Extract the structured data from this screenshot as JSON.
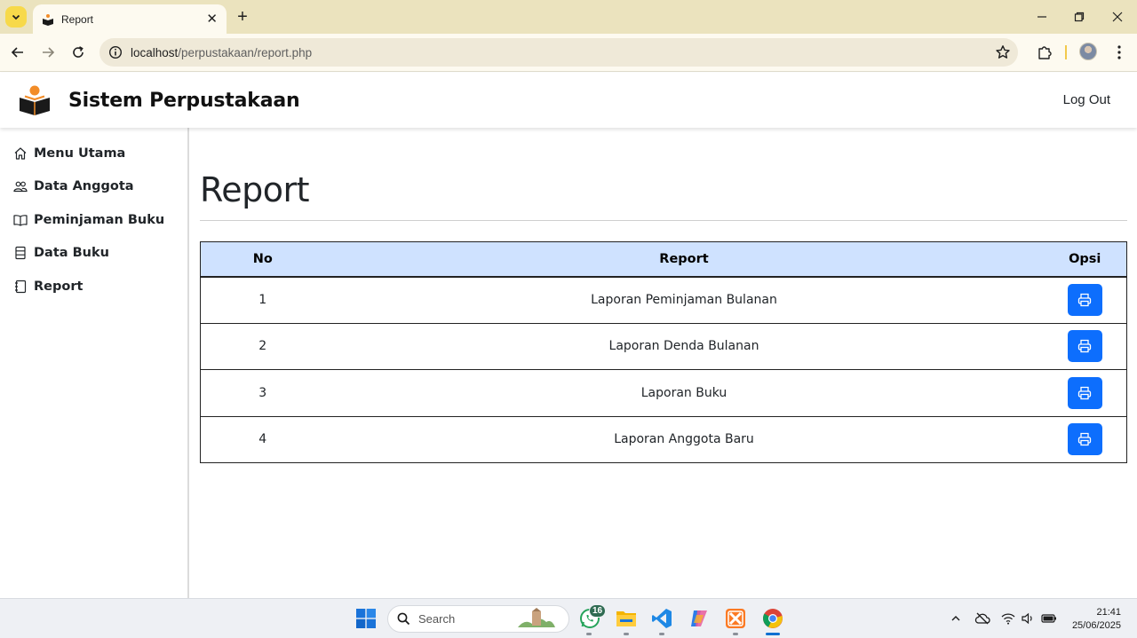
{
  "browser": {
    "tab_title": "Report",
    "url_host": "localhost",
    "url_path": "/perpustakaan/report.php"
  },
  "app": {
    "title": "Sistem Perpustakaan",
    "logout_label": "Log Out",
    "logo_icon": "open-book-reader-icon",
    "logo_colors": [
      "#f28c28",
      "#1a1a1a"
    ]
  },
  "sidebar": {
    "items": [
      {
        "label": "Menu Utama",
        "icon": "house-icon"
      },
      {
        "label": "Data Anggota",
        "icon": "people-icon"
      },
      {
        "label": "Peminjaman Buku",
        "icon": "book-icon"
      },
      {
        "label": "Data Buku",
        "icon": "stack-icon"
      },
      {
        "label": "Report",
        "icon": "journal-icon"
      }
    ]
  },
  "main": {
    "page_title": "Report",
    "table": {
      "columns": [
        "No",
        "Report",
        "Opsi"
      ],
      "header_color": "#cfe2ff",
      "button_color": "#0d6efd",
      "rows": [
        {
          "no": "1",
          "report": "Laporan Peminjaman Bulanan",
          "action_icon": "printer-icon"
        },
        {
          "no": "2",
          "report": "Laporan Denda Bulanan",
          "action_icon": "printer-icon"
        },
        {
          "no": "3",
          "report": "Laporan Buku",
          "action_icon": "printer-icon"
        },
        {
          "no": "4",
          "report": "Laporan Anggota Baru",
          "action_icon": "printer-icon"
        }
      ]
    }
  },
  "taskbar": {
    "search_placeholder": "Search",
    "whatsapp_badge": "16",
    "time": "21:41",
    "date": "25/06/2025"
  }
}
